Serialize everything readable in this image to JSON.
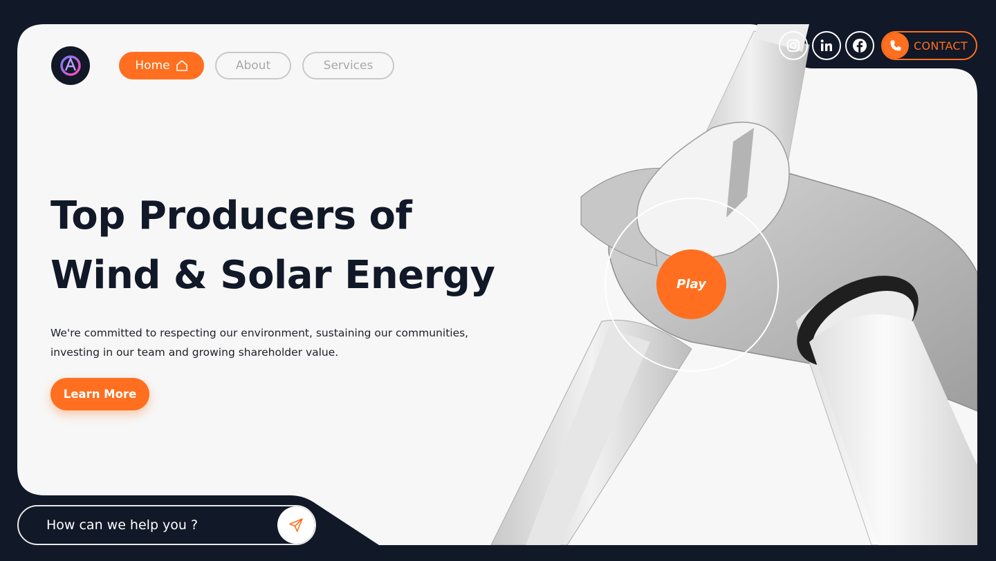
{
  "colors": {
    "accent": "#ff6f1f",
    "background": "#111827",
    "card": "#f7f7f7"
  },
  "brand": {
    "logo_icon": "logo-a-icon",
    "logo_letter": "A"
  },
  "nav": {
    "items": [
      {
        "label": "Home",
        "icon": "home-icon",
        "active": true
      },
      {
        "label": "About",
        "active": false
      },
      {
        "label": "Services",
        "active": false
      }
    ]
  },
  "hero": {
    "title_line1": "Top Producers of",
    "title_line2": "Wind & Solar Energy",
    "description": "We're committed to respecting our environment, sustaining our communities, investing in our team and growing shareholder value.",
    "cta_label": "Learn More"
  },
  "video": {
    "play_label": "Play"
  },
  "header_right": {
    "socials": [
      {
        "icon": "instagram-icon"
      },
      {
        "icon": "linkedin-icon"
      },
      {
        "icon": "facebook-icon"
      }
    ],
    "contact_label": "CONTACT",
    "contact_icon": "phone-icon"
  },
  "help": {
    "placeholder": "How can we help you ?",
    "send_icon": "send-icon"
  }
}
